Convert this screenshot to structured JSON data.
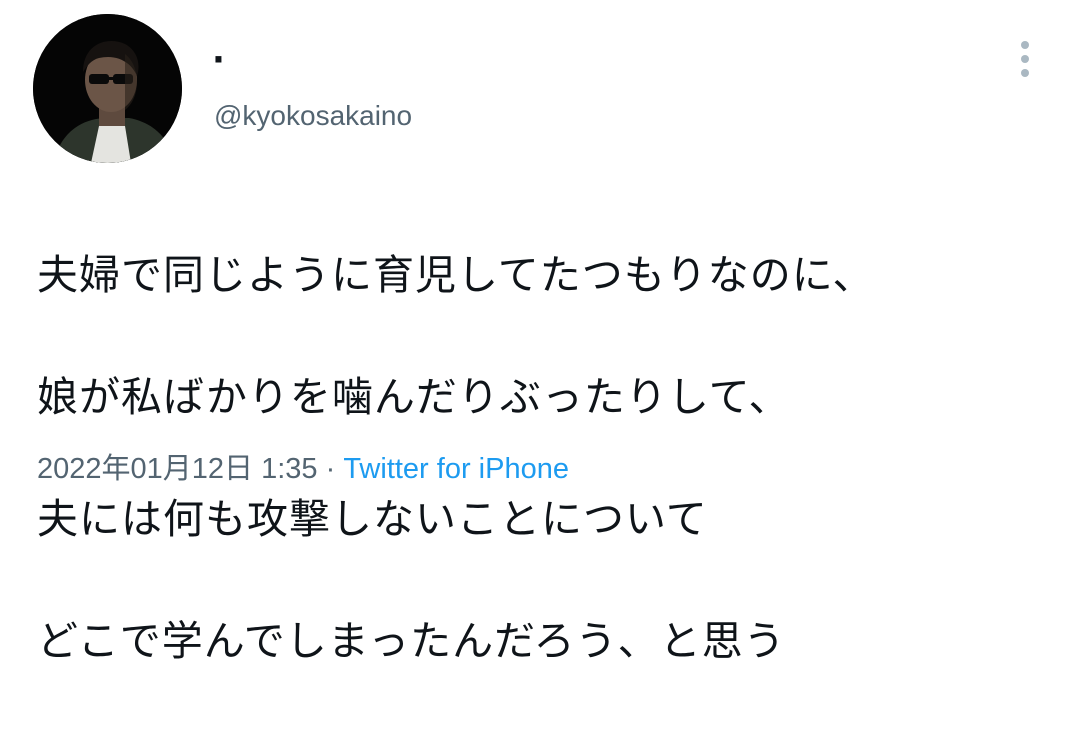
{
  "tweet": {
    "display_name": "·",
    "handle": "@kyokosakaino",
    "avatar_icon": "user-avatar",
    "more_icon": "more-vertical-icon",
    "text_lines": [
      "夫婦で同じように育児してたつもりなのに、",
      "娘が私ばかりを噛んだりぶったりして、",
      "夫には何も攻撃しないことについて",
      "どこで学んでしまったんだろう、と思う"
    ],
    "timestamp": "2022年01月12日 1:35",
    "separator": " · ",
    "source": "Twitter for iPhone"
  },
  "colors": {
    "text_primary": "#0f1419",
    "text_secondary": "#536471",
    "link": "#1d9bf0",
    "icon_gray": "#aab8c2"
  }
}
